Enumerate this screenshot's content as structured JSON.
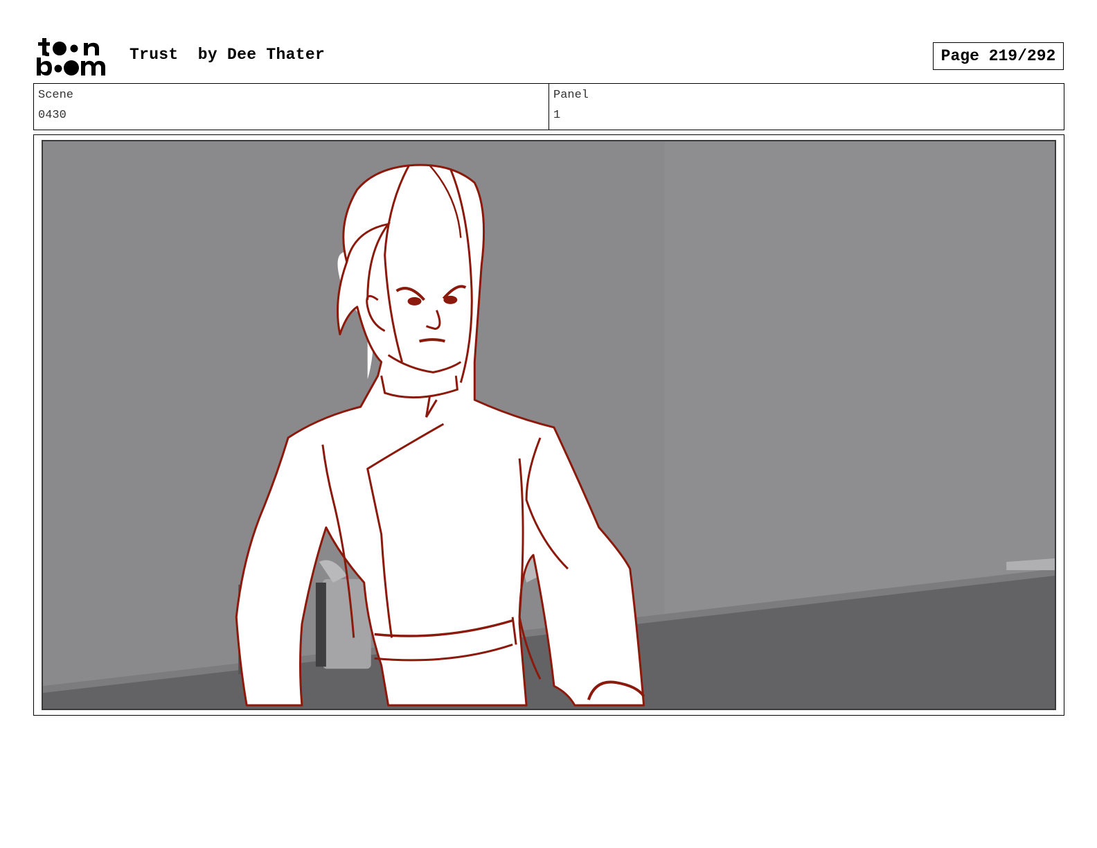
{
  "header": {
    "logo_text": "toon boom",
    "title": "Trust  by Dee Thater",
    "page": "Page 219/292"
  },
  "info": {
    "scene_label": "Scene",
    "scene_value": "0430",
    "panel_label": "Panel",
    "panel_value": "1"
  },
  "panel": {
    "image_description_icon": "storyboard-sketch",
    "colors": {
      "background_wall": "#8a8a8c",
      "floor": "#626264",
      "sketch_line": "#8b1a0c"
    }
  }
}
